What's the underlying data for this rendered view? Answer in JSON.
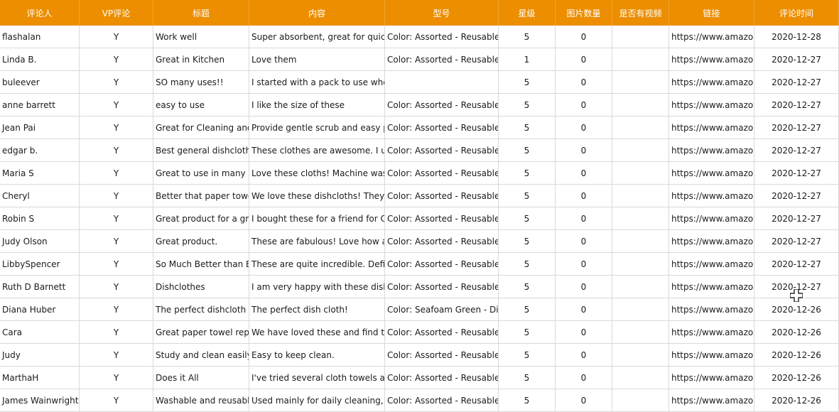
{
  "columns": [
    "评论人",
    "VP评论",
    "标题",
    "内容",
    "型号",
    "星级",
    "图片数量",
    "是否有视频",
    "链接",
    "评论时间"
  ],
  "rows": [
    [
      "flashalan",
      "Y",
      "Work well",
      "Super absorbent, great for quick w",
      "Color: Assorted - Reusable C",
      "5",
      "0",
      "",
      "https://www.amazon.",
      "2020-12-28"
    ],
    [
      "Linda B.",
      "Y",
      "Great in Kitchen",
      "Love them",
      "Color: Assorted - Reusable C",
      "1",
      "0",
      "",
      "https://www.amazon.",
      "2020-12-27"
    ],
    [
      "buleever",
      "Y",
      "SO many uses!!",
      "I started with a pack to use when",
      "",
      "5",
      "0",
      "",
      "https://www.amazon.",
      "2020-12-27"
    ],
    [
      "anne barrett",
      "Y",
      "easy to use",
      "I like the size of these",
      "Color: Assorted - Reusable C",
      "5",
      "0",
      "",
      "https://www.amazon.",
      "2020-12-27"
    ],
    [
      "Jean Pai",
      "Y",
      "Great for Cleaning and",
      "Provide gentle scrub and easy pol",
      "Color: Assorted - Reusable C",
      "5",
      "0",
      "",
      "https://www.amazon.",
      "2020-12-27"
    ],
    [
      "edgar b.",
      "Y",
      "Best general dishcloth",
      "These clothes are awesome. I use",
      "Color: Assorted - Reusable C",
      "5",
      "0",
      "",
      "https://www.amazon.",
      "2020-12-27"
    ],
    [
      "Maria S",
      "Y",
      "Great to use in many wa",
      "Love these cloths! Machine washa",
      "Color: Assorted - Reusable C",
      "5",
      "0",
      "",
      "https://www.amazon.",
      "2020-12-27"
    ],
    [
      "Cheryl",
      "Y",
      "Better that paper towels",
      "We love these dishcloths! They a",
      "Color: Assorted - Reusable C",
      "5",
      "0",
      "",
      "https://www.amazon.",
      "2020-12-27"
    ],
    [
      "Robin S",
      "Y",
      "Great product for a grea",
      "I bought these for a friend for Chr",
      "Color: Assorted - Reusable C",
      "5",
      "0",
      "",
      "https://www.amazon.",
      "2020-12-27"
    ],
    [
      "Judy Olson",
      "Y",
      "Great product.",
      "These are fabulous! Love how abs",
      "Color: Assorted - Reusable C",
      "5",
      "0",
      "",
      "https://www.amazon.",
      "2020-12-27"
    ],
    [
      "LibbySpencer",
      "Y",
      "So Much Better than Ex",
      "These are quite incredible. Definit",
      "Color: Assorted - Reusable C",
      "5",
      "0",
      "",
      "https://www.amazon.",
      "2020-12-27"
    ],
    [
      "Ruth D Barnett",
      "Y",
      "Dishclothes",
      "I am very happy with these dishclo",
      "Color: Assorted - Reusable C",
      "5",
      "0",
      "",
      "https://www.amazon.",
      "2020-12-27"
    ],
    [
      "Diana Huber",
      "Y",
      "The perfect dishcloth",
      "The perfect dish cloth!",
      "Color: Seafoam Green - Dis",
      "5",
      "0",
      "",
      "https://www.amazon.",
      "2020-12-26"
    ],
    [
      "Cara",
      "Y",
      "Great paper towel repla",
      "We have loved these and find tha",
      "Color: Assorted - Reusable C",
      "5",
      "0",
      "",
      "https://www.amazon.",
      "2020-12-26"
    ],
    [
      "Judy",
      "Y",
      "Study and clean easily",
      "Easy to keep clean.",
      "Color: Assorted - Reusable C",
      "5",
      "0",
      "",
      "https://www.amazon.",
      "2020-12-26"
    ],
    [
      "MarthaH",
      "Y",
      "Does it All",
      "I've tried several cloth towels after",
      "Color: Assorted - Reusable C",
      "5",
      "0",
      "",
      "https://www.amazon.",
      "2020-12-26"
    ],
    [
      "James Wainwright",
      "Y",
      "Washable and reusable",
      "Used mainly for daily cleaning, jus",
      "Color: Assorted - Reusable C",
      "5",
      "0",
      "",
      "https://www.amazon.",
      "2020-12-26"
    ]
  ],
  "colors": {
    "header_bg": "#ec8e00",
    "header_text": "#ffffff",
    "grid_line": "#d9d9d9"
  },
  "cursor_icon": "cell-select-cursor-icon"
}
